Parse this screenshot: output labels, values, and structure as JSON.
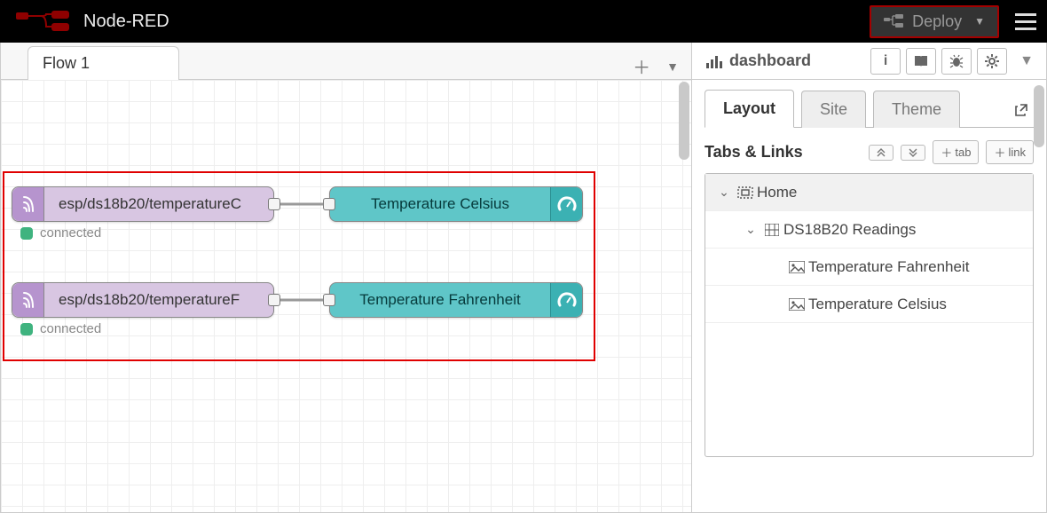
{
  "app": {
    "name": "Node-RED"
  },
  "header": {
    "deploy_label": "Deploy"
  },
  "workspace": {
    "tabs": [
      {
        "label": "Flow 1"
      }
    ]
  },
  "nodes": {
    "mqtt1": {
      "label": "esp/ds18b20/temperatureC",
      "status": "connected"
    },
    "mqtt2": {
      "label": "esp/ds18b20/temperatureF",
      "status": "connected"
    },
    "ui1": {
      "label": "Temperature Celsius"
    },
    "ui2": {
      "label": "Temperature Fahrenheit"
    }
  },
  "sidebar": {
    "title": "dashboard",
    "tabs": {
      "layout": "Layout",
      "site": "Site",
      "theme": "Theme"
    },
    "section_title": "Tabs & Links",
    "buttons": {
      "tab": "tab",
      "link": "link"
    },
    "tree": {
      "home": "Home",
      "group": "DS18B20 Readings",
      "item1": "Temperature Fahrenheit",
      "item2": "Temperature Celsius"
    }
  }
}
